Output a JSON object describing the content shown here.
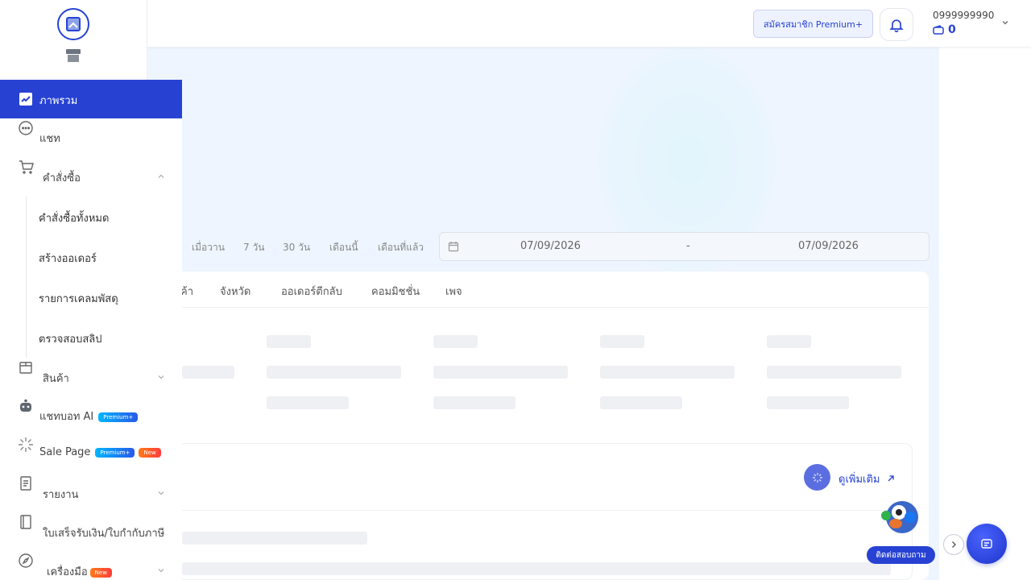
{
  "header": {
    "premium_button": "สมัครสมาชิก Premium+",
    "phone": "0999999990",
    "wallet_balance": "0"
  },
  "sidebar": {
    "items": [
      {
        "label": "ภาพรวม",
        "icon": "chart-line-icon",
        "active": true
      },
      {
        "label": "แชท",
        "icon": "chat-bubble-icon"
      },
      {
        "label": "คำสั่งซื้อ",
        "icon": "cart-icon",
        "expanded": true
      },
      {
        "label": "สินค้า",
        "icon": "box-icon"
      },
      {
        "label": "แชทบอท AI",
        "icon": "robot-icon",
        "badge": "Premium+"
      },
      {
        "label": "Sale Page",
        "icon": "sparkle-icon",
        "badge": "Premium+",
        "badge2": "New"
      },
      {
        "label": "รายงาน",
        "icon": "document-icon"
      },
      {
        "label": "ใบเสร็จรับเงิน/ใบกำกับภาษี",
        "icon": "receipt-icon"
      },
      {
        "label": "เครื่องมือ",
        "icon": "compass-icon",
        "badge2": "New"
      }
    ],
    "orders_sub": [
      "คำสั่งซื้อทั้งหมด",
      "สร้างออเดอร์",
      "รายการเคลมพัสดุ",
      "ตรวจสอบสลิป"
    ]
  },
  "filters": {
    "quick": [
      "เมื่อวาน",
      "7 วัน",
      "30 วัน",
      "เดือนนี้",
      "เดือนที่แล้ว"
    ],
    "start_date": "07/09/2026",
    "separator": "-",
    "end_date": "07/09/2026"
  },
  "tabs": [
    "ค้า",
    "จังหวัด",
    "ออเดอร์ตีกลับ",
    "คอมมิชชั่น",
    "เพจ"
  ],
  "see_more": "ดูเพิ่มเติม",
  "contact": "ติดต่อสอบถาม",
  "colors": {
    "accent": "#2742d3",
    "bg": "#eef5ff"
  }
}
